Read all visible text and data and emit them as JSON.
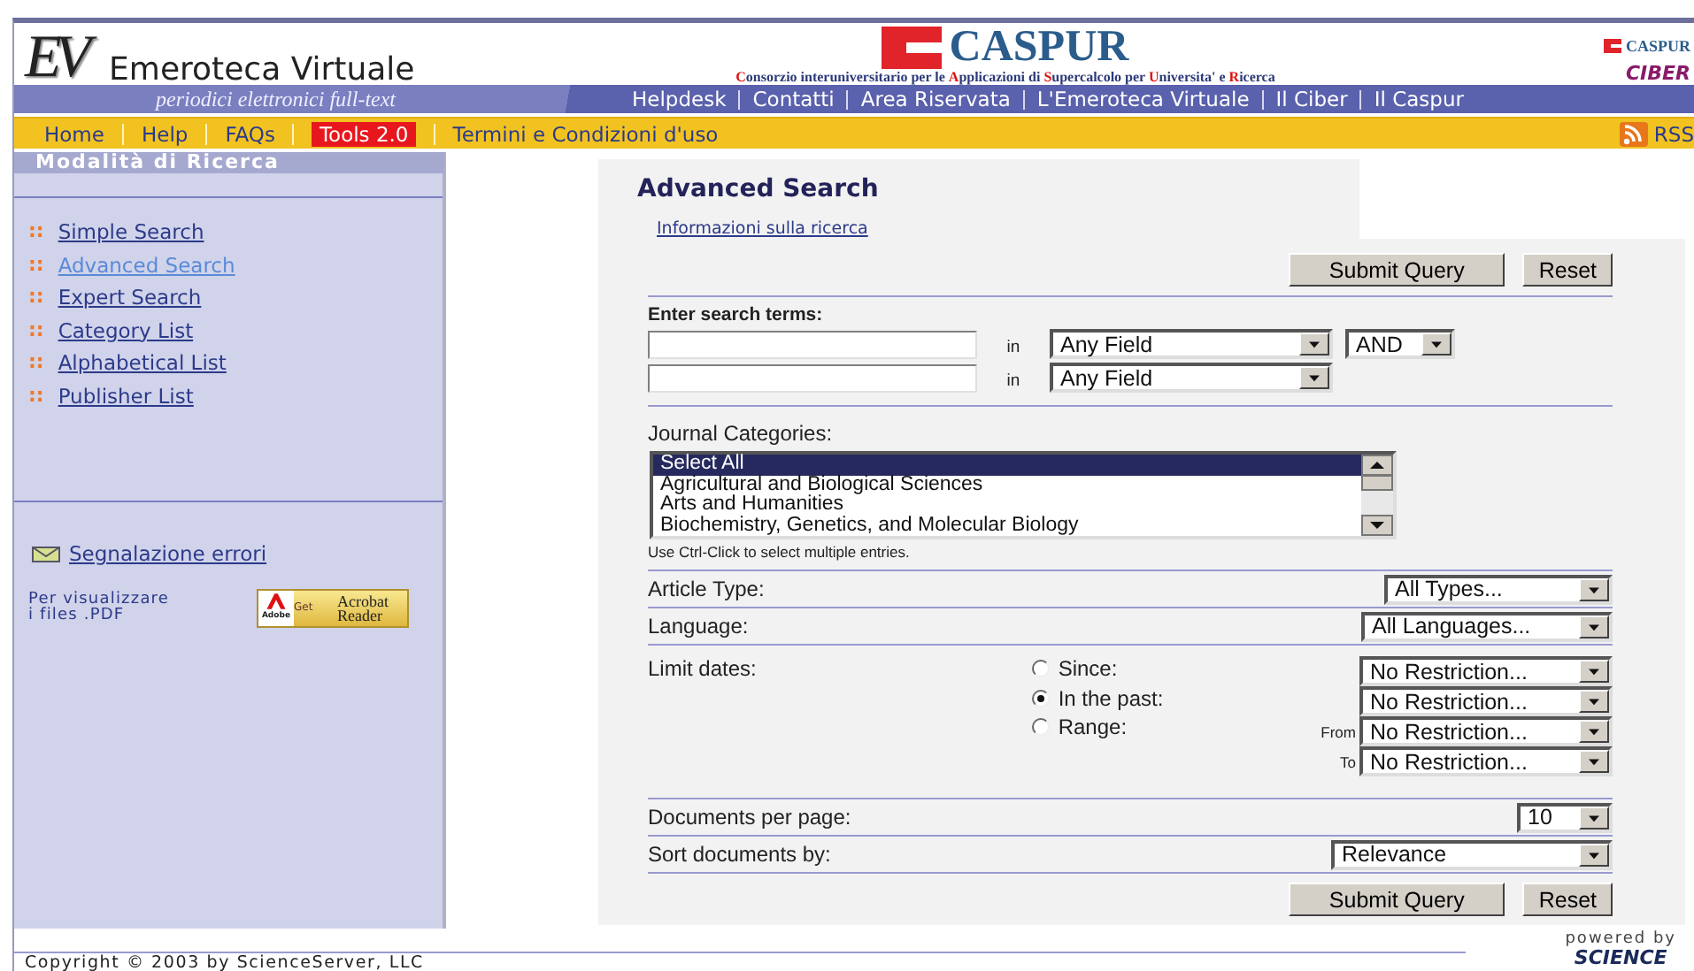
{
  "header": {
    "logo": "EV",
    "title": "Emeroteca Virtuale",
    "subtitle": "periodici elettronici full-text",
    "partner": {
      "name": "CASPUR",
      "tagline": "**C**onsorzio interuniversitario per le **A**pplicazioni di **S**upercalcolo per **U**niversita' e **R**icerca"
    },
    "corner_logos": [
      "CASPUR",
      "CIBER"
    ]
  },
  "top_nav": [
    "Helpdesk",
    "Contatti",
    "Area Riservata",
    "L'Emeroteca Virtuale",
    "Il Ciber",
    "Il Caspur"
  ],
  "menu": [
    {
      "label": "Home",
      "highlighted": false
    },
    {
      "label": "Help",
      "highlighted": false
    },
    {
      "label": "FAQs",
      "highlighted": false
    },
    {
      "label": "Tools 2.0",
      "highlighted": true
    },
    {
      "label": "Termini e Condizioni d'uso",
      "highlighted": false
    }
  ],
  "rss": "RSS",
  "sidebar": {
    "title": "Modalità di Ricerca",
    "links": [
      {
        "bullet": "::",
        "label": "Simple Search",
        "selected": false
      },
      {
        "bullet": "::",
        "label": "Advanced Search",
        "selected": true
      },
      {
        "bullet": "::",
        "label": "Expert Search",
        "selected": false
      },
      {
        "bullet": "::",
        "label": "Category List",
        "selected": false
      },
      {
        "bullet": "::",
        "label": "Alphabetical List",
        "selected": false
      },
      {
        "bullet": "::",
        "label": "Publisher List",
        "selected": false
      }
    ],
    "report_link": "Segnalazione errori",
    "pdf_note": "Per visualizzare\ni files .PDF",
    "acrobat_badge": {
      "get": "Get",
      "product": [
        "Acrobat",
        "Reader"
      ],
      "brand": "Adobe"
    }
  },
  "form": {
    "title": "Advanced Search",
    "info_link": "Informazioni sulla ricerca",
    "top_buttons": [
      "Submit Query",
      "Reset"
    ],
    "search_terms": {
      "label": "Enter search terms:",
      "rows": [
        {
          "in": "in",
          "field": "Any Field",
          "operator": "AND"
        },
        {
          "in": "in",
          "field": "Any Field"
        }
      ]
    },
    "journal_categories": {
      "label": "Journal Categories:",
      "options": [
        {
          "label": "Select All",
          "selected": true
        },
        {
          "label": "Agricultural and Biological Sciences",
          "selected": false
        },
        {
          "label": "Arts and Humanities",
          "selected": false
        },
        {
          "label": "Biochemistry, Genetics, and Molecular Biology",
          "selected": false
        }
      ],
      "hint": "Use Ctrl-Click to select multiple entries."
    },
    "option_rows": [
      {
        "kind": "select",
        "label": "Article Type:",
        "value": "All Types..."
      },
      {
        "kind": "select",
        "label": "Language:",
        "value": "All Languages..."
      },
      {
        "kind": "dates",
        "label": "Limit dates:",
        "choices": [
          {
            "label": "Since:",
            "selected": false
          },
          {
            "label": "In the past:",
            "selected": true
          },
          {
            "label": "Range:",
            "selected": false
          }
        ],
        "selects": [
          {
            "value": "No Restriction..."
          },
          {
            "value": "No Restriction..."
          },
          {
            "prefix": "From",
            "value": "No Restriction..."
          },
          {
            "prefix": "To",
            "value": "No Restriction..."
          }
        ]
      },
      {
        "kind": "select",
        "label": "Documents per page:",
        "value": "10"
      },
      {
        "kind": "select",
        "label": "Sort documents by:",
        "value": "Relevance"
      }
    ],
    "bottom_buttons": [
      "Submit Query",
      "Reset"
    ]
  },
  "footer": {
    "copyright": "Copyright © 2003 by ScienceServer, LLC",
    "powered_by": "powered by",
    "brand": "SCIENCE"
  }
}
